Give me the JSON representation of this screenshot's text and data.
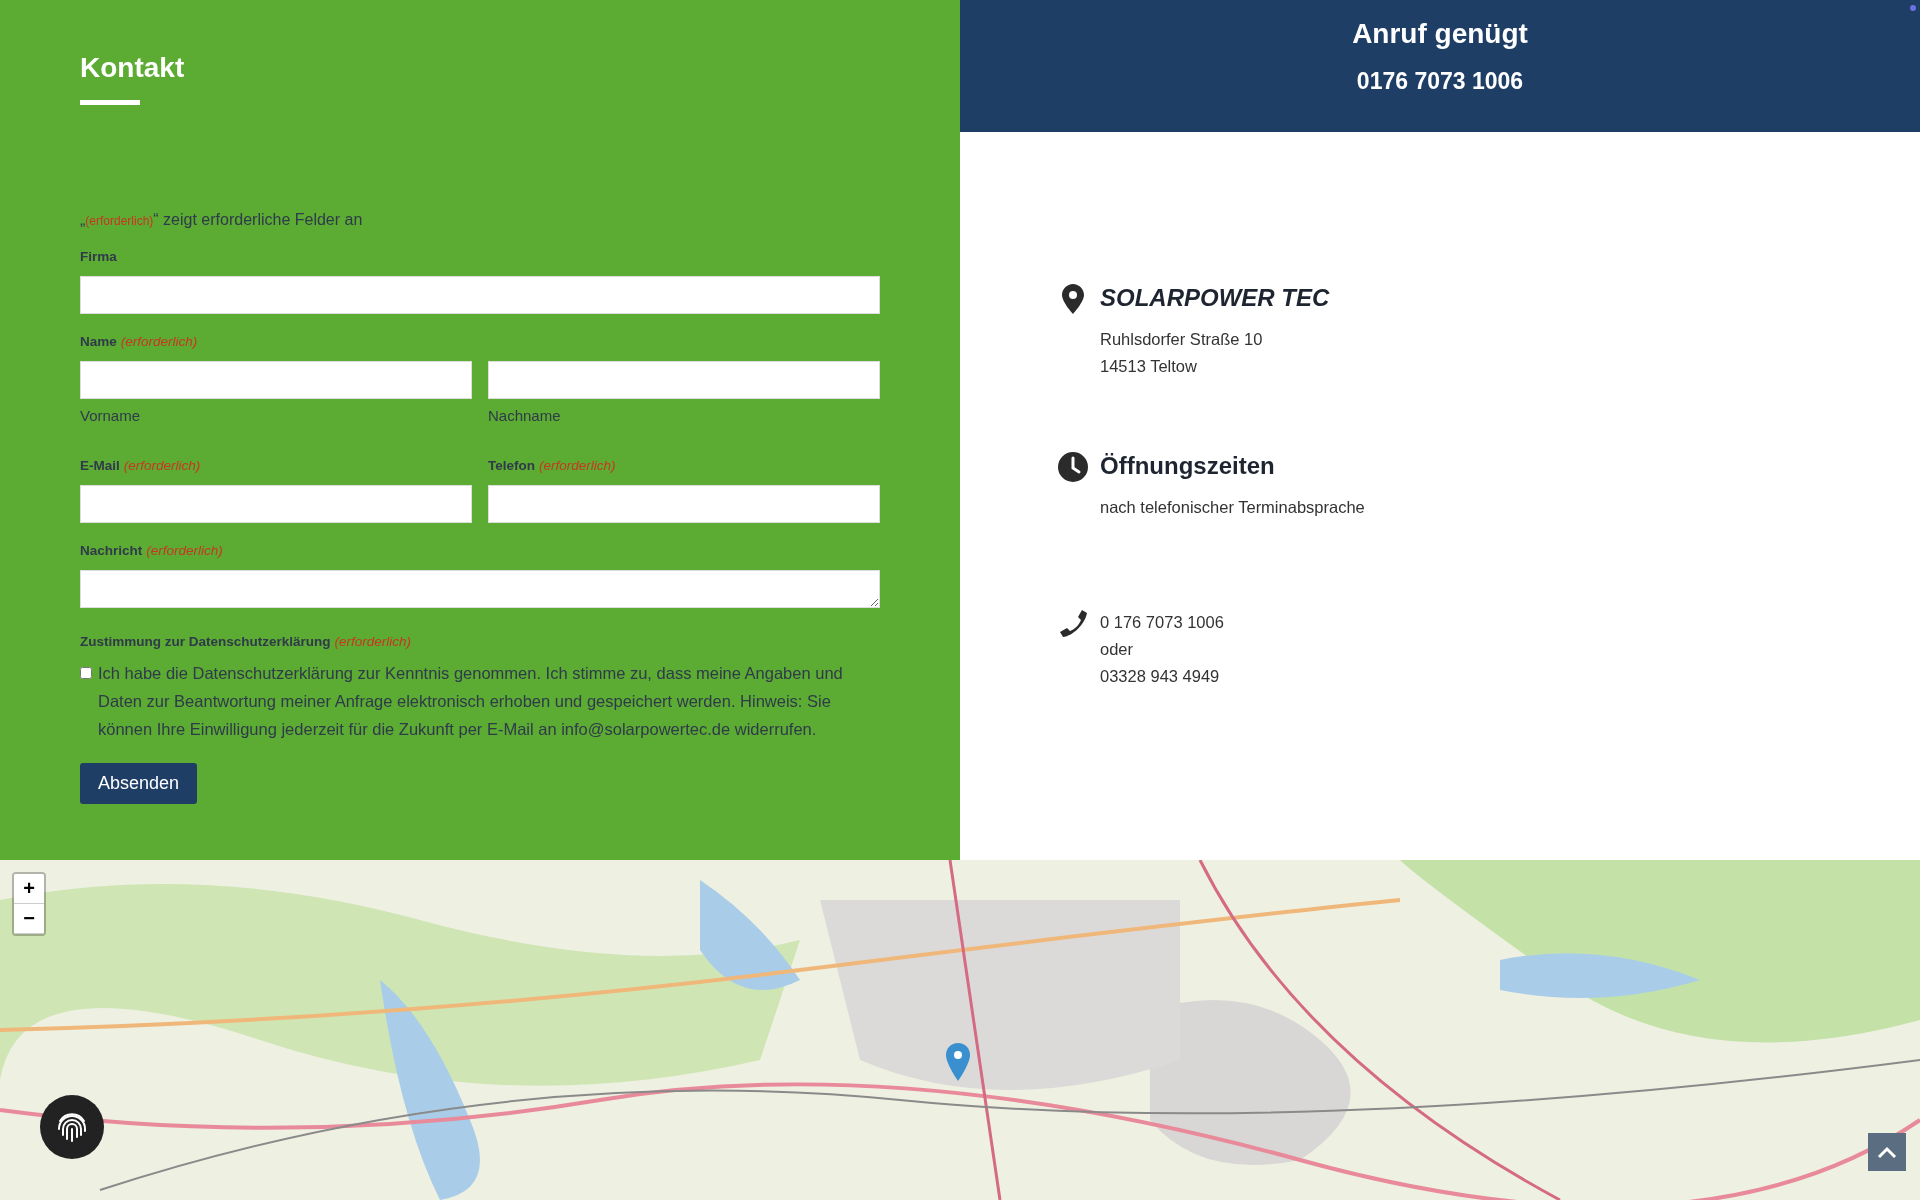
{
  "form": {
    "title": "Kontakt",
    "legend": {
      "open_quote": "„",
      "required_text": "(erforderlich)",
      "rest": "“ zeigt erforderliche Felder an"
    },
    "rows": [
      {
        "kind": "single",
        "label": "Firma"
      },
      {
        "kind": "split",
        "label": "Name",
        "required_text": "(erforderlich)",
        "sublabels": [
          "Vorname",
          "Nachname"
        ]
      },
      {
        "kind": "pair",
        "fields": [
          {
            "label": "E-Mail",
            "required_text": "(erforderlich)"
          },
          {
            "label": "Telefon",
            "required_text": "(erforderlich)"
          }
        ]
      },
      {
        "kind": "textarea",
        "label": "Nachricht",
        "required_text": "(erforderlich)"
      }
    ],
    "consent": {
      "label": "Zustimmung zur Datenschutzerklärung",
      "required_text": "(erforderlich)",
      "checked": false,
      "text": "Ich habe die Datenschutzerklärung zur Kenntnis genommen. Ich stimme zu, dass meine Angaben und Daten zur Beantwortung meiner Anfrage elektronisch erhoben und gespeichert werden. Hinweis: Sie können Ihre Einwilligung jederzeit für die Zukunft per E-Mail an info@solarpowertec.de widerrufen."
    },
    "submit": "Absenden"
  },
  "call_banner": {
    "title": "Anruf genügt",
    "phone": "0176 7073 1006"
  },
  "contact_blocks": [
    {
      "kind": "address",
      "title": "SOLARPOWER TEC",
      "lines": [
        "Ruhlsdorfer Straße 10",
        "14513 Teltow"
      ]
    },
    {
      "kind": "hours",
      "title": "Öffnungszeiten",
      "lines": [
        "nach telefonischer Terminabsprache"
      ]
    },
    {
      "kind": "phone",
      "lines": [
        "0 176 7073 1006",
        "oder",
        "03328 943 4949"
      ]
    }
  ],
  "map": {
    "kind": "picture",
    "zoom_in": "+",
    "zoom_out": "−"
  }
}
